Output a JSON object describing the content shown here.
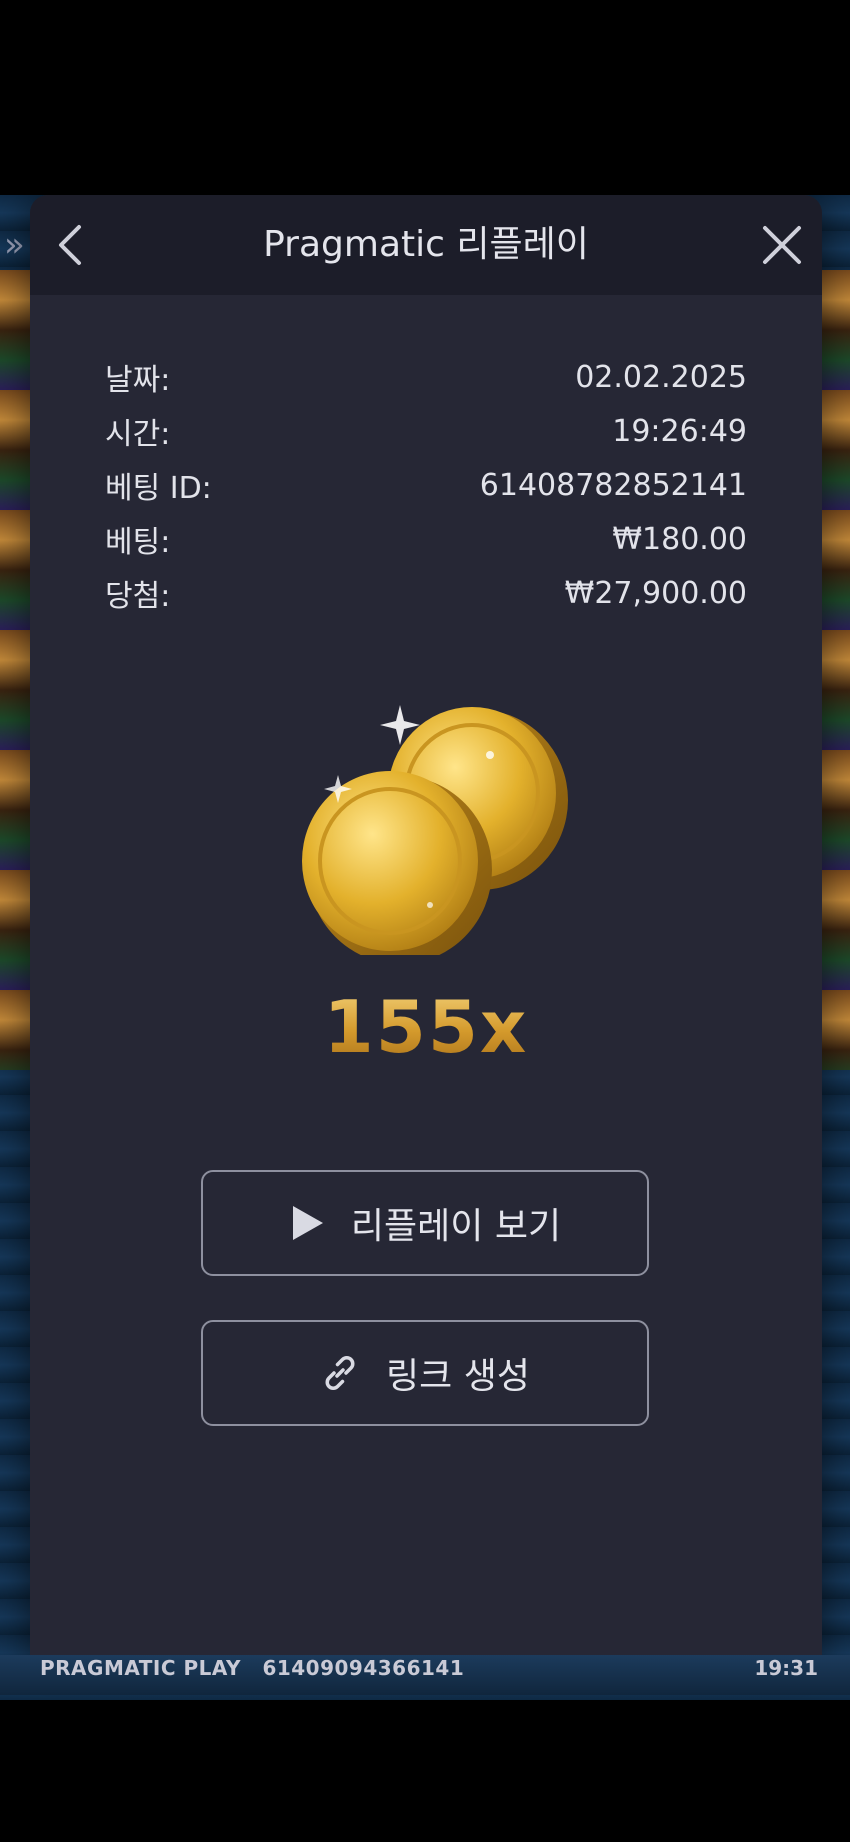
{
  "header": {
    "title": "Pragmatic 리플레이",
    "back_icon": "chevron-left-icon",
    "close_icon": "close-icon",
    "side_icon": "double-chevron-right-icon",
    "side_text": "»"
  },
  "details": [
    {
      "label": "날짜:",
      "value": "02.02.2025"
    },
    {
      "label": "시간:",
      "value": "19:26:49"
    },
    {
      "label": "베팅 ID:",
      "value": "61408782852141"
    },
    {
      "label": "베팅:",
      "value": "₩180.00"
    },
    {
      "label": "당첨:",
      "value": "₩27,900.00"
    }
  ],
  "result": {
    "coin_icon": "gold-coins-icon",
    "multiplier": "155x"
  },
  "buttons": {
    "replay_label": "리플레이 보기",
    "replay_icon": "play-icon",
    "link_label": "링크 생성",
    "link_icon": "link-icon"
  },
  "footer": {
    "brand": "PRAGMATIC PLAY",
    "game_id": "61409094366141",
    "time": "19:31"
  },
  "colors": {
    "modal_bg": "#262735",
    "header_bg": "#1c1d29",
    "text": "#e4e5ec",
    "gold": "#d7a43c"
  }
}
